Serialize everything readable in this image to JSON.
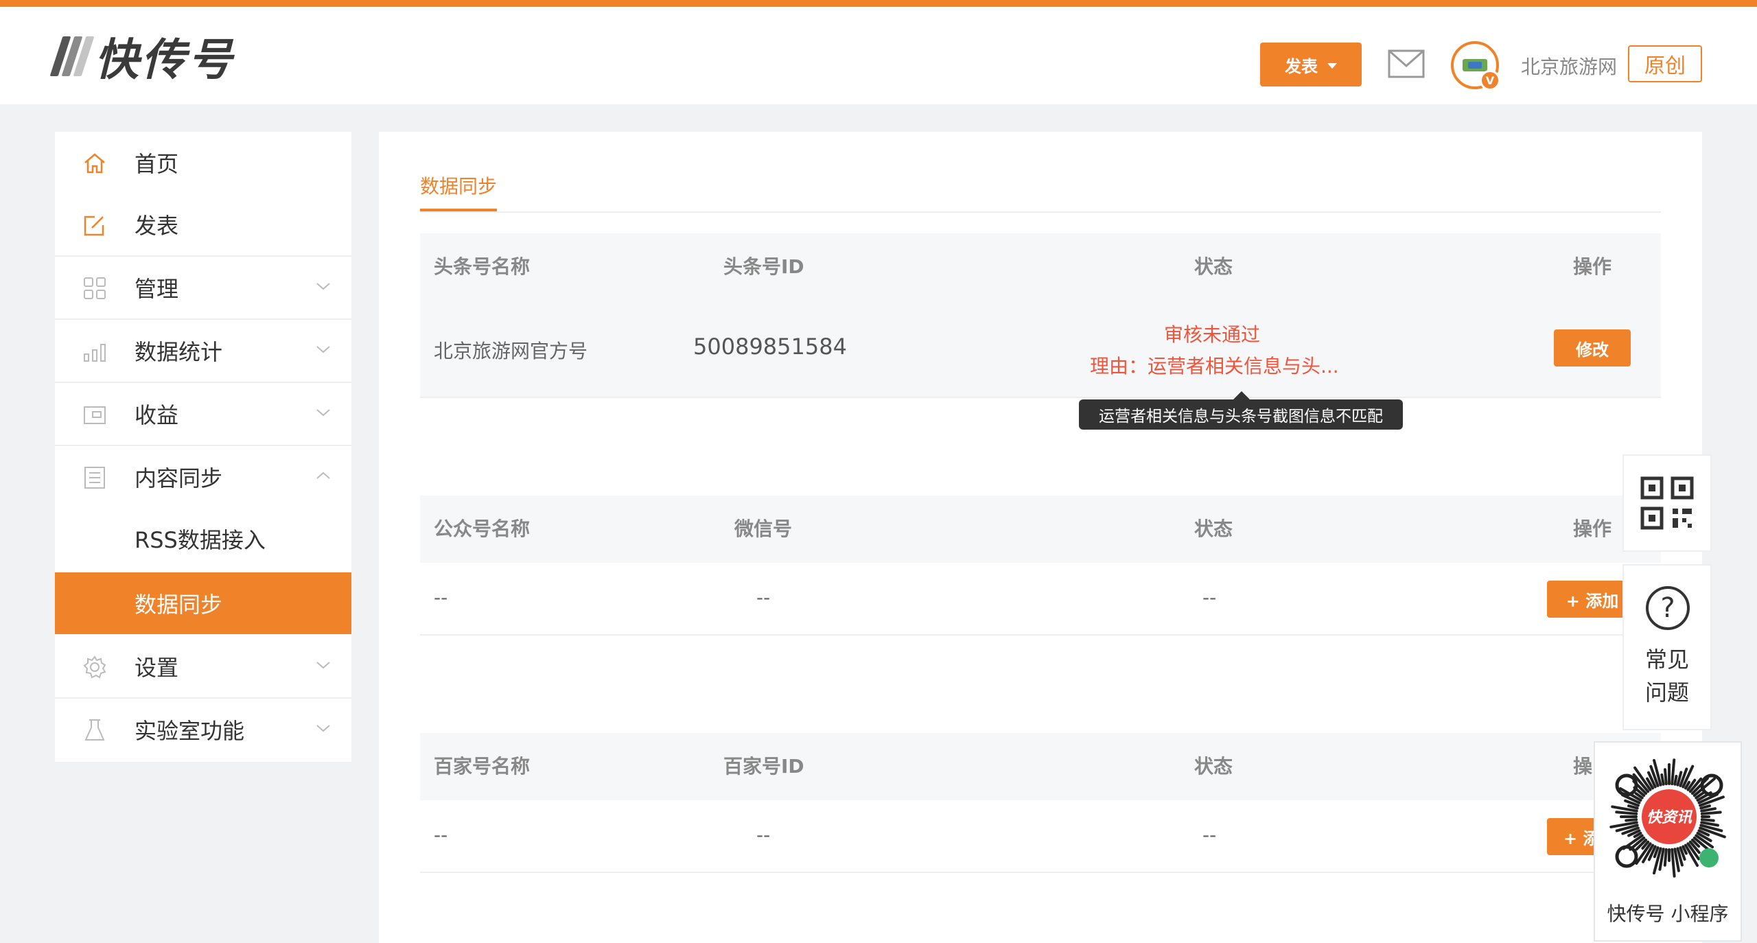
{
  "header": {
    "logo_text": "快传号",
    "publish_label": "发表",
    "account_name": "北京旅游网",
    "original_badge": "原创",
    "avatar_badge": "V",
    "colors": {
      "brand": "#f0822a",
      "logo_bars": [
        "#555555",
        "#8a8a8a",
        "#c4c4c4"
      ]
    }
  },
  "sidebar": {
    "items": [
      {
        "label": "首页",
        "icon": "home-icon"
      },
      {
        "label": "发表",
        "icon": "edit-icon"
      },
      {
        "label": "管理",
        "icon": "grid-icon"
      },
      {
        "label": "数据统计",
        "icon": "bar-chart-icon"
      },
      {
        "label": "收益",
        "icon": "wallet-icon"
      },
      {
        "label": "内容同步",
        "icon": "document-list-icon"
      },
      {
        "label": "RSS数据接入"
      },
      {
        "label": "数据同步"
      },
      {
        "label": "设置",
        "icon": "gear-icon"
      },
      {
        "label": "实验室功能",
        "icon": "flask-icon"
      }
    ]
  },
  "main": {
    "tab": "数据同步",
    "toutiao": {
      "headers": [
        "头条号名称",
        "头条号ID",
        "状态",
        "操作"
      ],
      "row": {
        "name": "北京旅游网官方号",
        "id": "50089851584",
        "status": "审核未通过",
        "reason": "理由：运营者相关信息与头...",
        "action": "修改"
      },
      "tooltip": "运营者相关信息与头条号截图信息不匹配"
    },
    "wechat": {
      "headers": [
        "公众号名称",
        "微信号",
        "状态",
        "操作"
      ],
      "row": {
        "name": "--",
        "id": "--",
        "status": "--",
        "action": "+ 添加"
      }
    },
    "baijia": {
      "headers": [
        "百家号名称",
        "百家号ID",
        "状态",
        "操"
      ],
      "row": {
        "name": "--",
        "id": "--",
        "status": "--",
        "action": "+ 添"
      }
    }
  },
  "floating": {
    "qr_icon": "qr-code-icon",
    "faq_icon": "question-circle-icon",
    "faq_line1": "常见",
    "faq_line2": "问题",
    "mini_program_badge": "快资讯",
    "mini_program_label": "快传号 小程序"
  }
}
